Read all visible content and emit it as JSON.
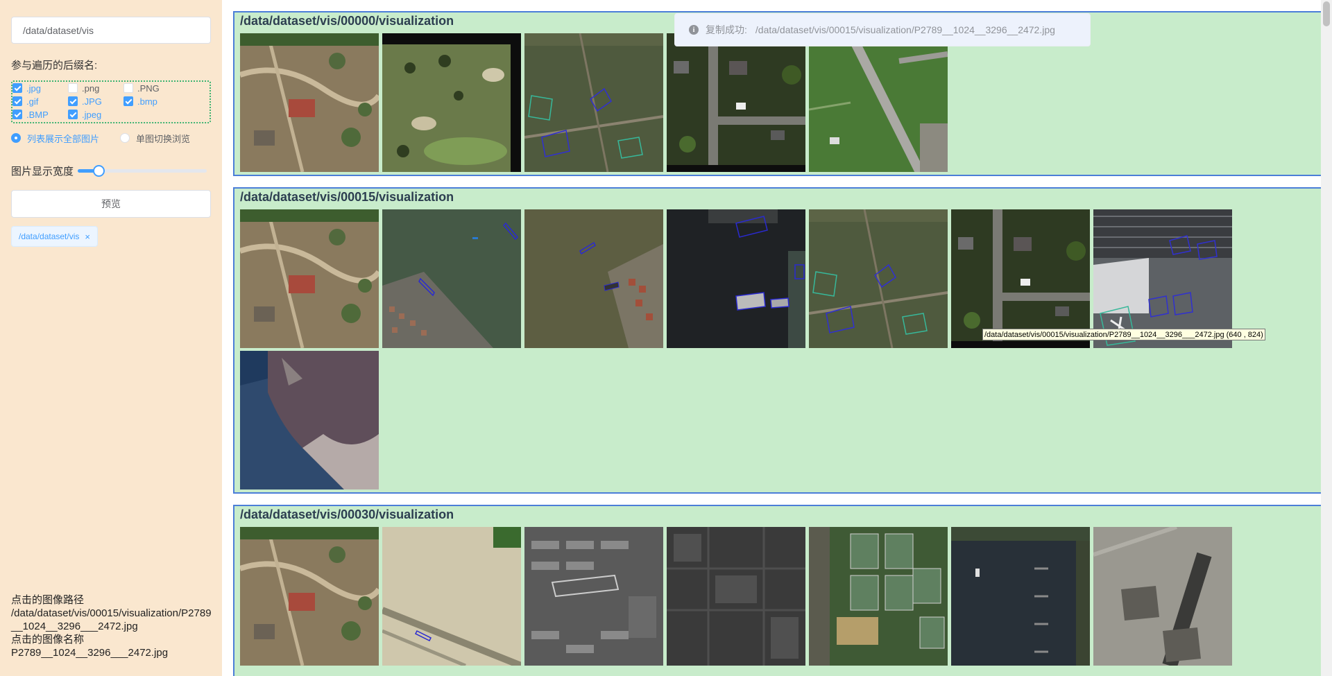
{
  "sidebar": {
    "path_value": "/data/dataset/vis",
    "suffix_label": "参与遍历的后缀名:",
    "extensions": [
      {
        "label": ".jpg",
        "checked": true
      },
      {
        "label": ".png",
        "checked": false
      },
      {
        "label": ".PNG",
        "checked": false
      },
      {
        "label": ".gif",
        "checked": true
      },
      {
        "label": ".JPG",
        "checked": true
      },
      {
        "label": ".bmp",
        "checked": true
      },
      {
        "label": ".BMP",
        "checked": true
      },
      {
        "label": ".jpeg",
        "checked": true
      }
    ],
    "radio_list": "列表展示全部图片",
    "radio_single": "单图切换浏览",
    "width_label": "图片显示宽度",
    "width_slider_fraction": 0.16,
    "preview_button": "预览",
    "tag_label": "/data/dataset/vis",
    "tag_close": "×",
    "clicked_path_label": "点击的图像路径",
    "clicked_path_value": "/data/dataset/vis/00015/visualization/P2789__1024__3296___2472.jpg",
    "clicked_name_label": "点击的图像名称",
    "clicked_name_value": "P2789__1024__3296___2472.jpg"
  },
  "groups": [
    {
      "title": "/data/dataset/vis/00000/visualization",
      "thumbs": [
        "farm",
        "golf",
        "fields",
        "suburb",
        "airport"
      ]
    },
    {
      "title": "/data/dataset/vis/00015/visualization",
      "thumbs": [
        "farm",
        "harbor",
        "port",
        "darkharbor",
        "fields",
        "suburb",
        "airport2",
        "coast"
      ]
    },
    {
      "title": "/data/dataset/vis/00030/visualization",
      "thumbs": [
        "farm",
        "sand",
        "grayblocks",
        "darkgray",
        "tennis",
        "river",
        "tarmac"
      ]
    }
  ],
  "toast": {
    "icon": "i",
    "message": "复制成功:",
    "path": "/data/dataset/vis/00015/visualization/P2789__1024__3296__2472.jpg"
  },
  "tooltip": "/data/dataset/vis/00015/visualization/P2789__1024__3296___2472.jpg (640 , 824)",
  "colors": {
    "sidebar_bg": "#fae7cf",
    "group_bg": "#c8eccb",
    "group_border": "#4b7ed8",
    "accent": "#409eff"
  }
}
